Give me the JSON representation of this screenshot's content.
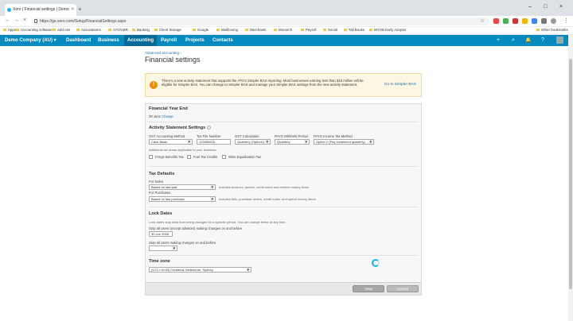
{
  "browser": {
    "tab_title": "Xero | Financial settings | Demo",
    "tab_close": "×",
    "new_tab": "+",
    "url": "https://go.xero.com/Setup/FinancialSettings.aspx",
    "minimize": "–",
    "maximize": "□",
    "close": "×",
    "back": "←",
    "forward": "→",
    "reload": "×",
    "star": "☆",
    "menu": "⋮"
  },
  "bookmarks": [
    "Apps",
    "Accounting software",
    "Add-ons",
    "Associations",
    "ATO/ABR",
    "Banking",
    "Client Storage",
    "Google",
    "Mailboxing",
    "Merchants",
    "Monarch",
    "Payroll",
    "Social",
    "Tall Books",
    "MYOB Early Adopter",
    "Other bookmarks"
  ],
  "xero_nav": {
    "org": "Demo Company (AU) ▾",
    "items": [
      "Dashboard",
      "Business",
      "Accounting",
      "Payroll",
      "Projects",
      "Contacts"
    ],
    "active": "Accounting",
    "icons": {
      "add": "+",
      "search": "⌕",
      "notifications": "🔔",
      "help": "?"
    }
  },
  "page": {
    "breadcrumb": "Advanced accounting ›",
    "title": "Financial settings"
  },
  "notice": {
    "icon": "!",
    "text": "There's a new activity statement that supports the ATO's Simpler BAS reporting. Most businesses earning less than $10 million will be eligible for Simpler BAS. You can change to Simpler BAS and manage your Simpler BAS settings from the new activity statement.",
    "link": "Go to Simpler BAS"
  },
  "fye": {
    "heading": "Financial Year End",
    "value": "30 June",
    "change": "Change"
  },
  "activity": {
    "heading": "Activity Statement Settings",
    "gst_method_label": "GST Accounting Method",
    "gst_method_value": "Cash Basis",
    "tfn_label": "Tax File Number",
    "tfn_value": "123456616",
    "gst_calc_label": "GST Calculation",
    "gst_calc_value": "Quarterly (Option1)",
    "payg_withheld_label": "PAYG Withheld Period",
    "payg_withheld_value": "Quarterly",
    "payg_income_label": "PAYG Income Tax Method",
    "payg_income_value": "Option 1 (Pay instalment quarterly)",
    "additional": "Additional tax areas applicable to your business",
    "fbt": "Fringe Benefits Tax",
    "fuel": "Fuel Tax Credits",
    "wet": "Wine Equalisation Tax"
  },
  "tax_defaults": {
    "heading": "Tax Defaults",
    "sales_label": "For Sales",
    "sales_value": "Based on last sale",
    "sales_note": "Includes invoices, quotes, credit notes and receive money items",
    "purch_label": "For Purchases",
    "purch_value": "Based on last purchase",
    "purch_note": "Includes bills, purchase orders, credit notes, and spend money items"
  },
  "lock": {
    "heading": "Lock Dates",
    "desc": "Lock dates stop data from being changed for a specific period. You can change these at any time.",
    "advisors_label": "Stop all users (except advisors) making changes on and before",
    "advisors_value": "30 Jun 2008",
    "all_label": "Stop all users making changes on and before",
    "all_value": ""
  },
  "timezone": {
    "heading": "Time zone",
    "value": "(UTC+10:00) Canberra, Melbourne, Sydney"
  },
  "footer": {
    "save": "Save",
    "cancel": "Cancel"
  }
}
